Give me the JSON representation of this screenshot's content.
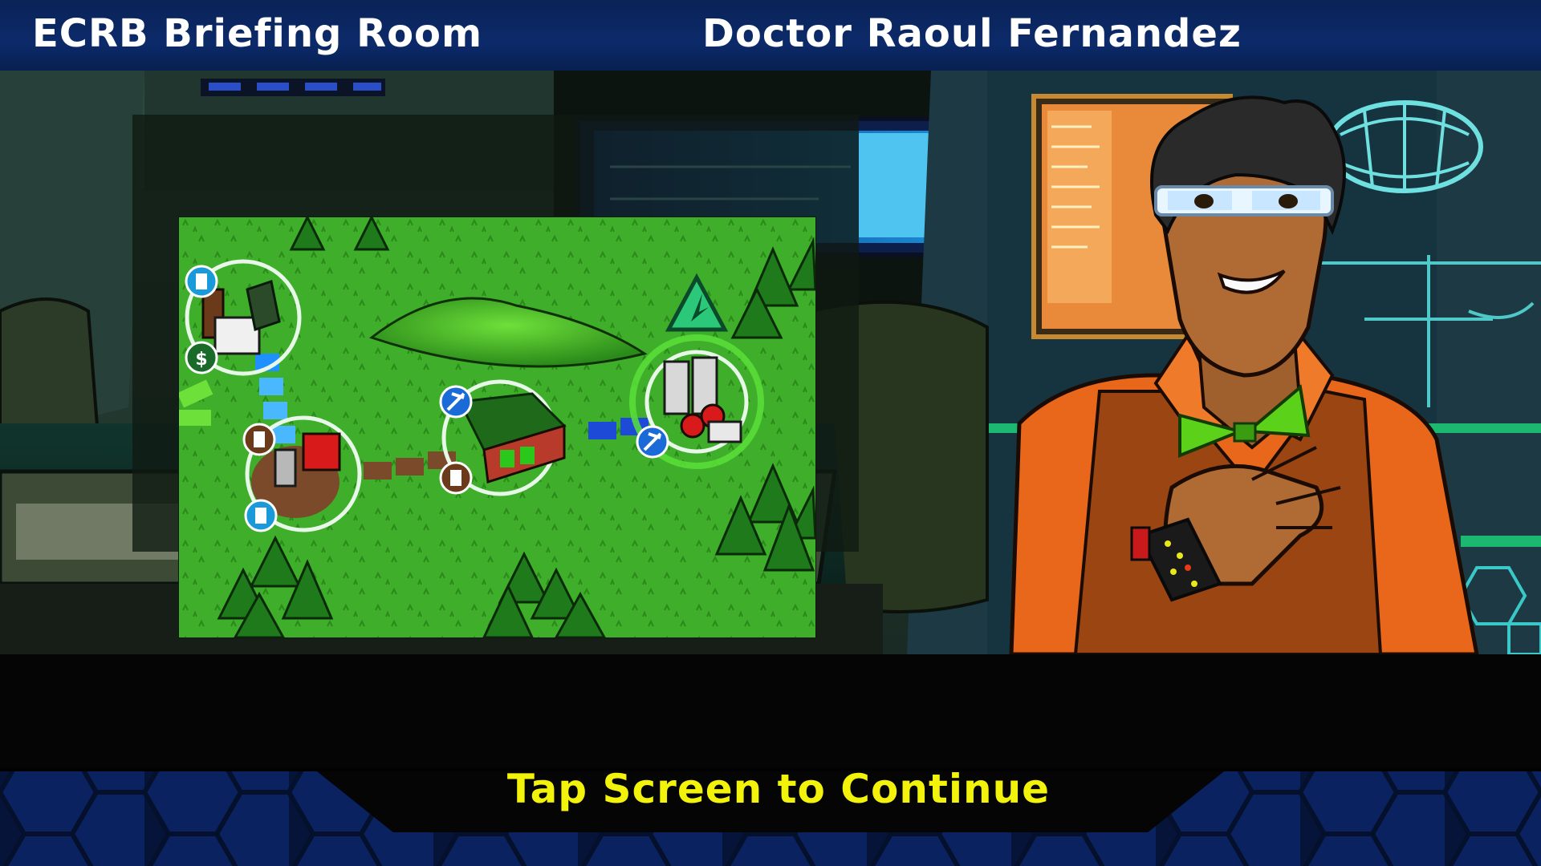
{
  "header": {
    "location_title": "ECRB Briefing Room",
    "speaker_name": "Doctor Raoul Fernandez"
  },
  "footer": {
    "continue_prompt": "Tap Screen to Continue"
  },
  "colors": {
    "header_bg": "#0c2a6a",
    "prompt_text": "#f2f20a",
    "grass": "#3fae2a",
    "road_blue": "#1e90ff",
    "road_brown": "#7a4a2a",
    "shirt_orange": "#e8671a",
    "bowtie_green": "#5bd11a"
  },
  "map": {
    "icons": [
      "trash-icon",
      "money-icon",
      "pickaxe-icon",
      "power-plant-icon",
      "barn-icon",
      "factory-icon",
      "warning-triangle-icon"
    ]
  }
}
